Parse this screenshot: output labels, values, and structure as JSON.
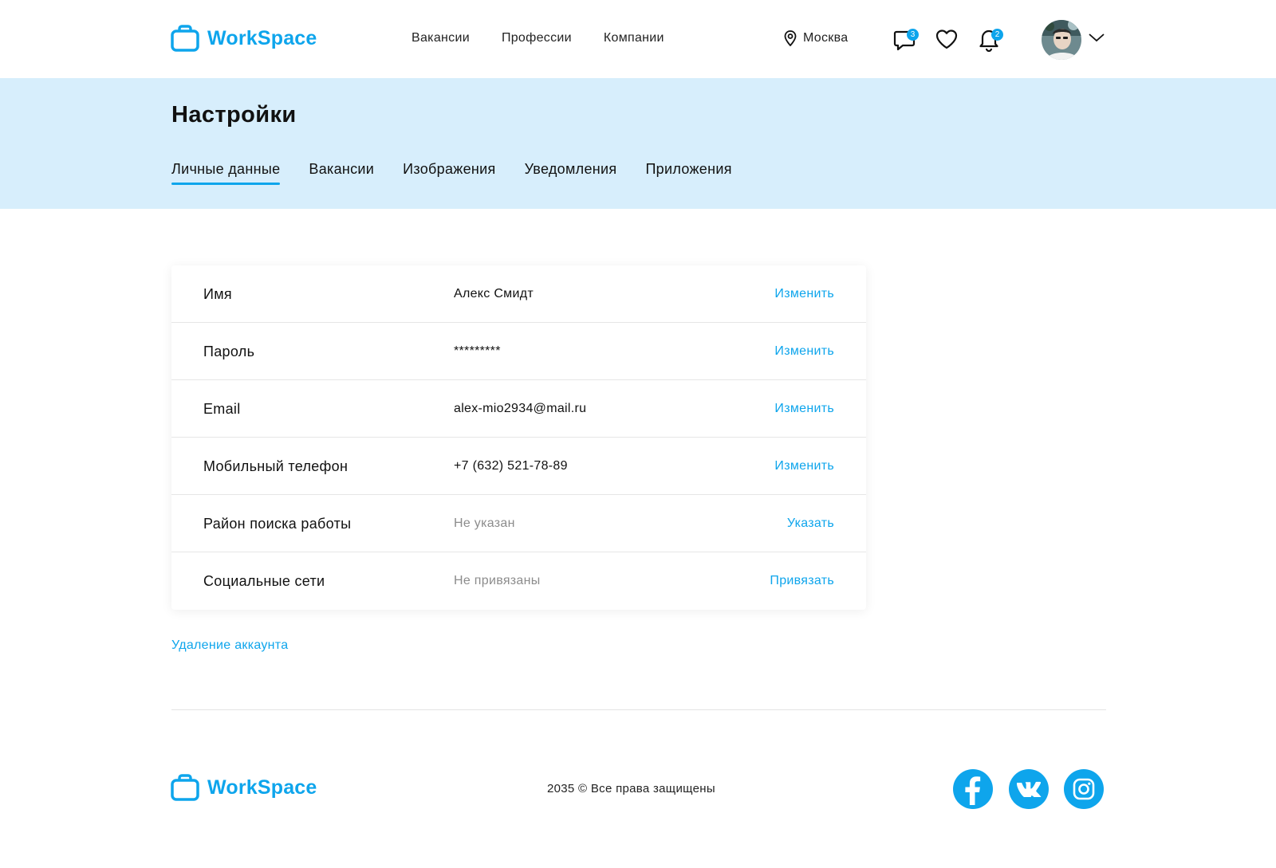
{
  "brand": {
    "name": "WorkSpace",
    "color": "#0ea5ec"
  },
  "nav": {
    "items": [
      "Вакансии",
      "Профессии",
      "Компании"
    ]
  },
  "location": {
    "city": "Москва",
    "icon": "map-pin-icon"
  },
  "header_icons": {
    "messages": {
      "icon": "chat-bubble-icon",
      "badge": "3"
    },
    "favorites": {
      "icon": "heart-icon"
    },
    "notifications": {
      "icon": "bell-icon",
      "badge": "2"
    },
    "profile_menu": {
      "icon": "chevron-down-icon"
    }
  },
  "page": {
    "title": "Настройки",
    "tabs": [
      {
        "label": "Личные данные",
        "active": true
      },
      {
        "label": "Вакансии",
        "active": false
      },
      {
        "label": "Изображения",
        "active": false
      },
      {
        "label": "Уведомления",
        "active": false
      },
      {
        "label": "Приложения",
        "active": false
      }
    ]
  },
  "settings": {
    "rows": [
      {
        "label": "Имя",
        "value": "Алекс Смидт",
        "action": "Изменить"
      },
      {
        "label": "Пароль",
        "value": "*********",
        "action": "Изменить"
      },
      {
        "label": "Email",
        "value": "alex-mio2934@mail.ru",
        "action": "Изменить"
      },
      {
        "label": "Мобильный телефон",
        "value": "+7 (632) 521-78-89",
        "action": "Изменить"
      },
      {
        "label": "Район поиска работы",
        "value": "Не указан",
        "action": "Указать"
      },
      {
        "label": "Социальные сети",
        "value": "Не привязаны",
        "action": "Привязать"
      }
    ],
    "delete_account": "Удаление аккаунта"
  },
  "footer": {
    "copyright": "2035 © Все права защищены",
    "social": [
      "facebook-icon",
      "vk-icon",
      "instagram-icon"
    ]
  },
  "colors": {
    "accent": "#0ea5ec",
    "banner": "#d7eefc",
    "muted": "#8c8c8c"
  }
}
